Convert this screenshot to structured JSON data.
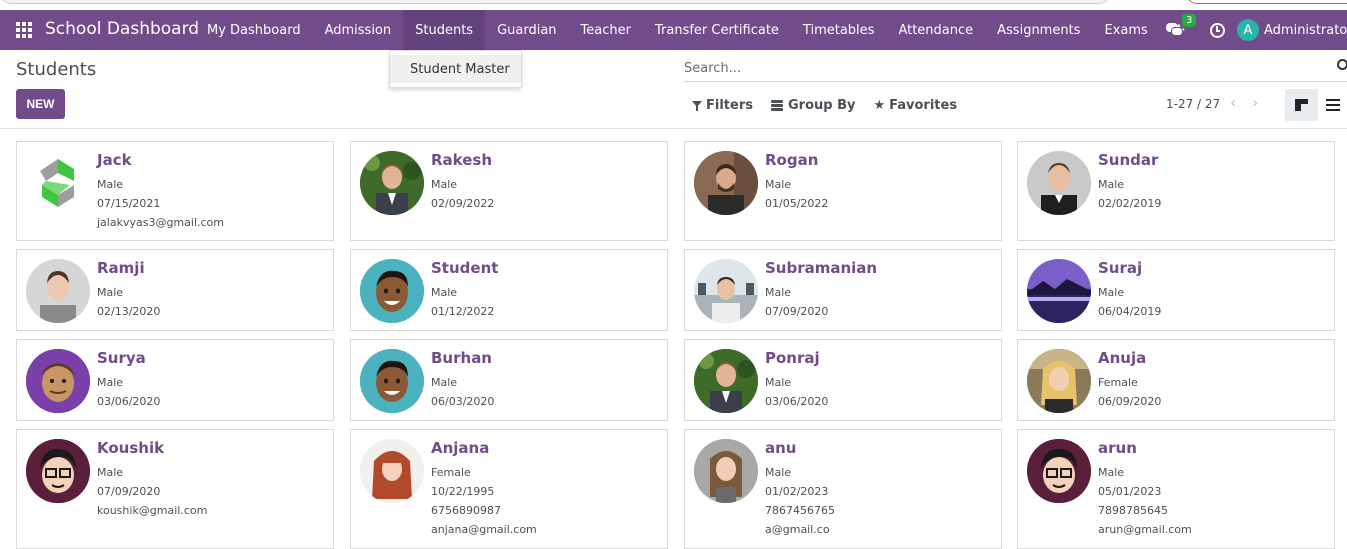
{
  "app": {
    "title": "School Dashboard",
    "user": "Administrator",
    "user_initial": "A",
    "chat_badge": "3",
    "brand_color": "#714b8a"
  },
  "nav": {
    "items": [
      {
        "label": "My Dashboard"
      },
      {
        "label": "Admission"
      },
      {
        "label": "Students",
        "active": true
      },
      {
        "label": "Guardian"
      },
      {
        "label": "Teacher"
      },
      {
        "label": "Transfer Certificate"
      },
      {
        "label": "Timetables"
      },
      {
        "label": "Attendance"
      },
      {
        "label": "Assignments"
      },
      {
        "label": "Exams"
      }
    ],
    "plus": "+"
  },
  "dropdown": {
    "item": "Student Master"
  },
  "control": {
    "title": "Students",
    "new_label": "NEW",
    "search_placeholder": "Search...",
    "filters": "Filters",
    "group_by": "Group By",
    "favorites": "Favorites",
    "pager": "1-27 / 27",
    "prev": "‹",
    "next": "›"
  },
  "students": [
    {
      "name": "Jack",
      "gender": "Male",
      "dob": "07/15/2021",
      "phone": "",
      "email": "jalakvyas3@gmail.com",
      "avatar": "logo"
    },
    {
      "name": "Rakesh",
      "gender": "Male",
      "dob": "02/09/2022",
      "phone": "",
      "email": "",
      "avatar": "photo-green"
    },
    {
      "name": "Rogan",
      "gender": "Male",
      "dob": "01/05/2022",
      "phone": "",
      "email": "",
      "avatar": "photo-brown"
    },
    {
      "name": "Sundar",
      "gender": "Male",
      "dob": "02/02/2019",
      "phone": "",
      "email": "",
      "avatar": "photo-grey"
    },
    {
      "name": "Ramji",
      "gender": "Male",
      "dob": "02/13/2020",
      "phone": "",
      "email": "",
      "avatar": "photo-light"
    },
    {
      "name": "Student",
      "gender": "Male",
      "dob": "01/12/2022",
      "phone": "",
      "email": "",
      "avatar": "cartoon-teal"
    },
    {
      "name": "Subramanian",
      "gender": "Male",
      "dob": "07/09/2020",
      "phone": "",
      "email": "",
      "avatar": "photo-beach"
    },
    {
      "name": "Suraj",
      "gender": "Male",
      "dob": "06/04/2019",
      "phone": "",
      "email": "",
      "avatar": "landscape-purple"
    },
    {
      "name": "Surya",
      "gender": "Male",
      "dob": "03/06/2020",
      "phone": "",
      "email": "",
      "avatar": "cartoon-purple"
    },
    {
      "name": "Burhan",
      "gender": "Male",
      "dob": "06/03/2020",
      "phone": "",
      "email": "",
      "avatar": "cartoon-teal"
    },
    {
      "name": "Ponraj",
      "gender": "Male",
      "dob": "03/06/2020",
      "phone": "",
      "email": "",
      "avatar": "photo-green"
    },
    {
      "name": "Anuja",
      "gender": "Female",
      "dob": "06/09/2020",
      "phone": "",
      "email": "",
      "avatar": "photo-blonde"
    },
    {
      "name": "Koushik",
      "gender": "Male",
      "dob": "07/09/2020",
      "phone": "",
      "email": "koushik@gmail.com",
      "avatar": "cartoon-glasses"
    },
    {
      "name": "Anjana",
      "gender": "Female",
      "dob": "10/22/1995",
      "phone": "6756890987",
      "email": "anjana@gmail.com",
      "avatar": "photo-red-hair"
    },
    {
      "name": "anu",
      "gender": "Male",
      "dob": "01/02/2023",
      "phone": "7867456765",
      "email": "a@gmail.co",
      "avatar": "photo-woman"
    },
    {
      "name": "arun",
      "gender": "Male",
      "dob": "05/01/2023",
      "phone": "7898785645",
      "email": "arun@gmail.com",
      "avatar": "cartoon-glasses"
    }
  ]
}
